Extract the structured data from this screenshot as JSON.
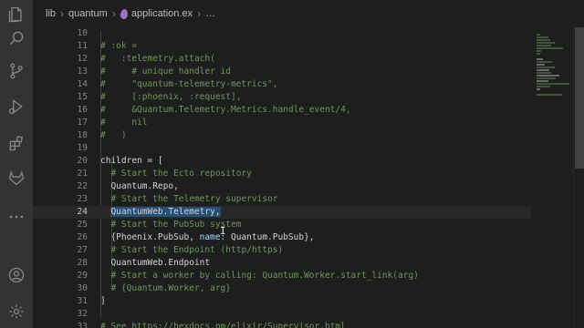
{
  "breadcrumbs": {
    "items": [
      "lib",
      "quantum",
      "application.ex",
      "…"
    ],
    "separator": "›"
  },
  "activity_bar": {
    "icons": [
      "explorer-icon",
      "search-icon",
      "source-control-icon",
      "run-debug-icon",
      "extensions-icon",
      "gitlab-icon",
      "more-icon",
      "account-icon",
      "settings-icon"
    ]
  },
  "editor": {
    "current_line": "24",
    "lines": [
      {
        "n": "10",
        "parts": [
          {
            "t": "",
            "c": ""
          }
        ]
      },
      {
        "n": "11",
        "parts": [
          {
            "t": "# :ok =",
            "c": "cmt"
          }
        ]
      },
      {
        "n": "12",
        "parts": [
          {
            "t": "#   :telemetry.attach(",
            "c": "cmt"
          }
        ]
      },
      {
        "n": "13",
        "parts": [
          {
            "t": "#     # unique handler id",
            "c": "cmt"
          }
        ]
      },
      {
        "n": "14",
        "parts": [
          {
            "t": "#     \"quantum-telemetry-metrics\",",
            "c": "cmt"
          }
        ]
      },
      {
        "n": "15",
        "parts": [
          {
            "t": "#     [:phoenix, :request],",
            "c": "cmt"
          }
        ]
      },
      {
        "n": "16",
        "parts": [
          {
            "t": "#     &Quantum.Telemetry.Metrics.handle_event/4,",
            "c": "cmt"
          }
        ]
      },
      {
        "n": "17",
        "parts": [
          {
            "t": "#     nil",
            "c": "cmt"
          }
        ]
      },
      {
        "n": "18",
        "parts": [
          {
            "t": "#   )",
            "c": "cmt"
          }
        ]
      },
      {
        "n": "19",
        "parts": [
          {
            "t": "",
            "c": ""
          }
        ]
      },
      {
        "n": "20",
        "parts": [
          {
            "t": "children = [",
            "c": ""
          }
        ]
      },
      {
        "n": "21",
        "parts": [
          {
            "t": "  ",
            "c": ""
          },
          {
            "t": "# Start the Ecto repository",
            "c": "cmt"
          }
        ]
      },
      {
        "n": "22",
        "parts": [
          {
            "t": "  Quantum.Repo,",
            "c": ""
          }
        ]
      },
      {
        "n": "23",
        "parts": [
          {
            "t": "  ",
            "c": ""
          },
          {
            "t": "# Start the Telemetry supervisor",
            "c": "cmt"
          }
        ]
      },
      {
        "n": "24",
        "parts": [
          {
            "t": "  ",
            "c": ""
          },
          {
            "t": "QuantumWeb.Telemetry,",
            "c": "sel"
          }
        ]
      },
      {
        "n": "25",
        "parts": [
          {
            "t": "  ",
            "c": ""
          },
          {
            "t": "# Start the PubSub system",
            "c": "cmt"
          }
        ]
      },
      {
        "n": "26",
        "parts": [
          {
            "t": "  {Phoenix.PubSub, ",
            "c": ""
          },
          {
            "t": "name:",
            "c": "kw"
          },
          {
            "t": " Quantum.PubSub},",
            "c": ""
          }
        ]
      },
      {
        "n": "27",
        "parts": [
          {
            "t": "  ",
            "c": ""
          },
          {
            "t": "# Start the Endpoint (http/https)",
            "c": "cmt"
          }
        ]
      },
      {
        "n": "28",
        "parts": [
          {
            "t": "  QuantumWeb.Endpoint",
            "c": ""
          }
        ]
      },
      {
        "n": "29",
        "parts": [
          {
            "t": "  ",
            "c": ""
          },
          {
            "t": "# Start a worker by calling: Quantum.Worker.start_link(arg)",
            "c": "cmt"
          }
        ]
      },
      {
        "n": "30",
        "parts": [
          {
            "t": "  ",
            "c": ""
          },
          {
            "t": "# {Quantum.Worker, arg}",
            "c": "cmt"
          }
        ]
      },
      {
        "n": "31",
        "parts": [
          {
            "t": "]",
            "c": ""
          }
        ]
      },
      {
        "n": "32",
        "parts": [
          {
            "t": "",
            "c": ""
          }
        ]
      },
      {
        "n": "33",
        "parts": [
          {
            "t": "# See ",
            "c": "cmt"
          },
          {
            "t": "https://hexdocs.pm/elixir/Supervisor.html",
            "c": "url"
          }
        ]
      }
    ]
  },
  "colors": {
    "background": "#1e1e1e",
    "activity_bar": "#333333",
    "comment": "#6a9955",
    "selection": "#264f78",
    "text": "#d4d4d4",
    "line_number": "#858585"
  }
}
